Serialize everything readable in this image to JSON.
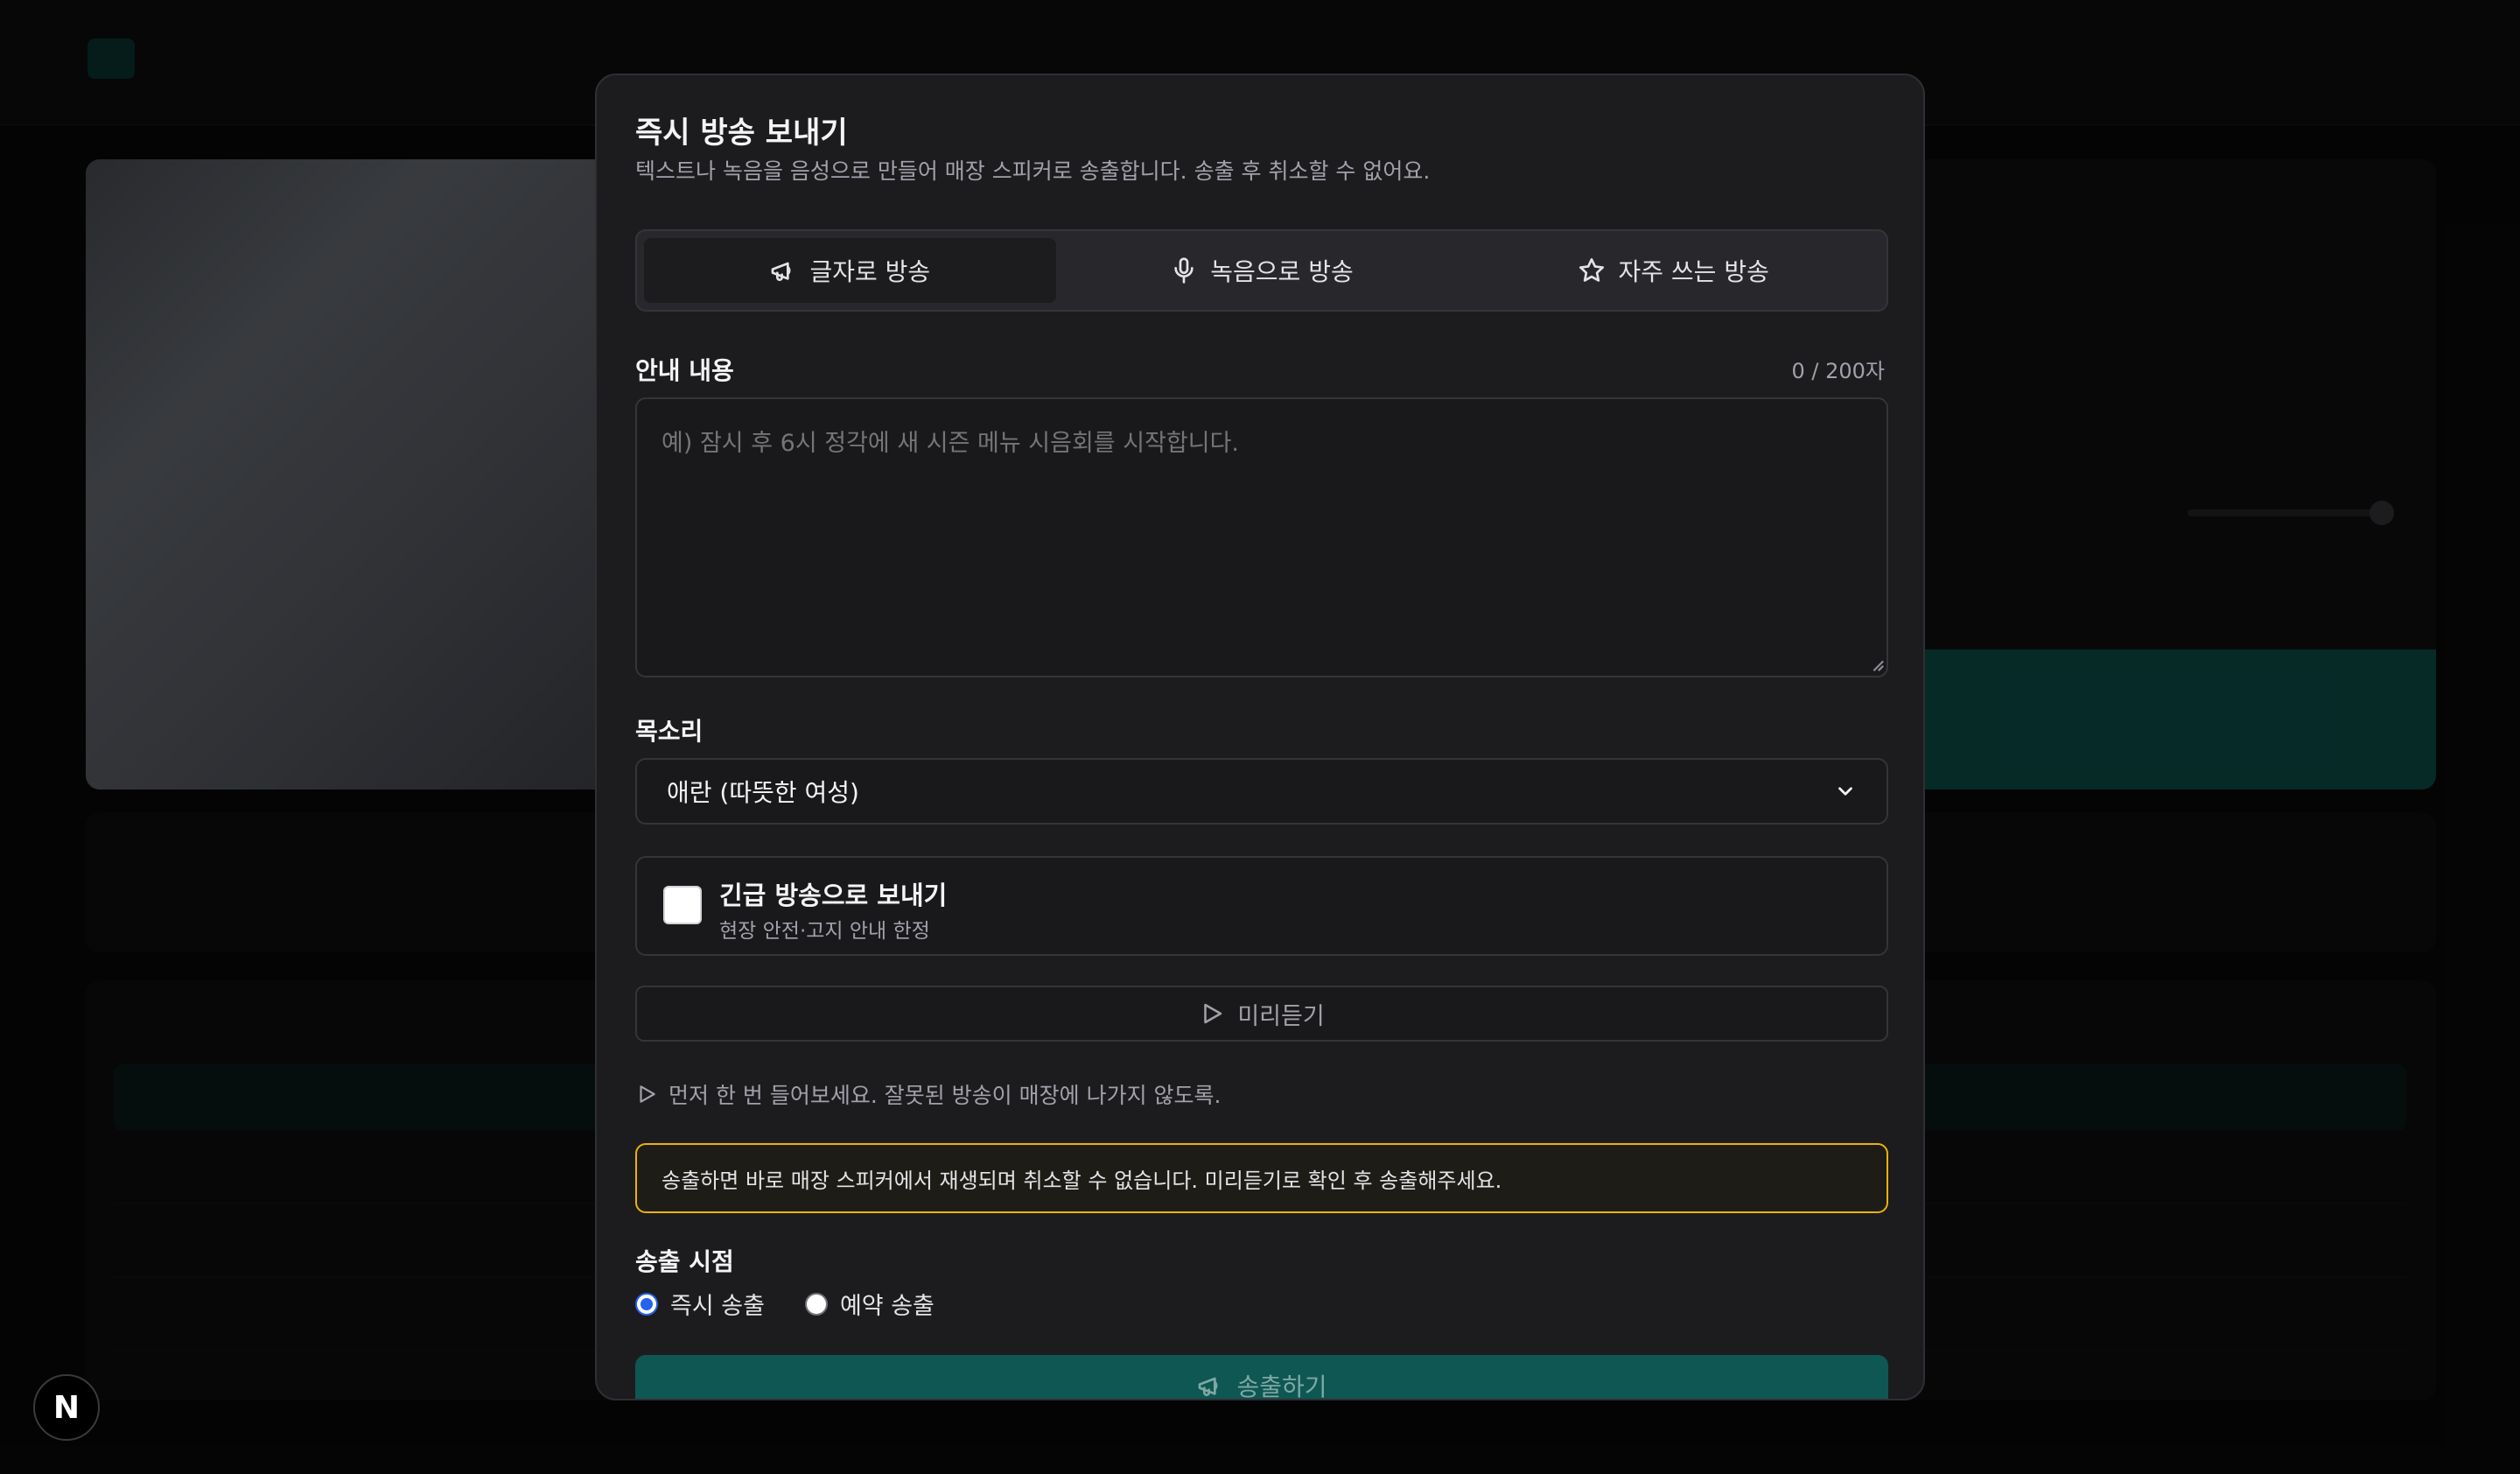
{
  "dialog": {
    "title": "즉시 방송 보내기",
    "subtitle": "텍스트나 녹음을 음성으로 만들어 매장 스피커로 송출합니다. 송출 후 취소할 수 없어요."
  },
  "tabs": [
    {
      "label": "글자로 방송",
      "icon": "megaphone-icon",
      "active": true
    },
    {
      "label": "녹음으로 방송",
      "icon": "microphone-icon",
      "active": false
    },
    {
      "label": "자주 쓰는 방송",
      "icon": "star-icon",
      "active": false
    }
  ],
  "message": {
    "label": "안내 내용",
    "counter": "0 / 200자",
    "placeholder": "예) 잠시 후 6시 정각에 새 시즌 메뉴 시음회를 시작합니다.",
    "value": ""
  },
  "voice": {
    "label": "목소리",
    "selected": "애란 (따뜻한 여성)"
  },
  "urgent": {
    "title": "긴급 방송으로 보내기",
    "subtitle": "현장 안전·고지 안내 한정",
    "checked": false
  },
  "preview": {
    "button_label": "미리듣기",
    "hint": "먼저 한 번 들어보세요. 잘못된 방송이 매장에 나가지 않도록."
  },
  "warning": {
    "text": "송출하면 바로 매장 스피커에서 재생되며 취소할 수 없습니다. 미리듣기로 확인 후 송출해주세요.",
    "border_color": "#eab308"
  },
  "timing": {
    "label": "송출 시점",
    "options": [
      {
        "label": "즉시 송출",
        "selected": true
      },
      {
        "label": "예약 송출",
        "selected": false
      }
    ]
  },
  "submit": {
    "label": "송출하기",
    "color": "#0f5753"
  },
  "badge": {
    "letter": "N"
  }
}
